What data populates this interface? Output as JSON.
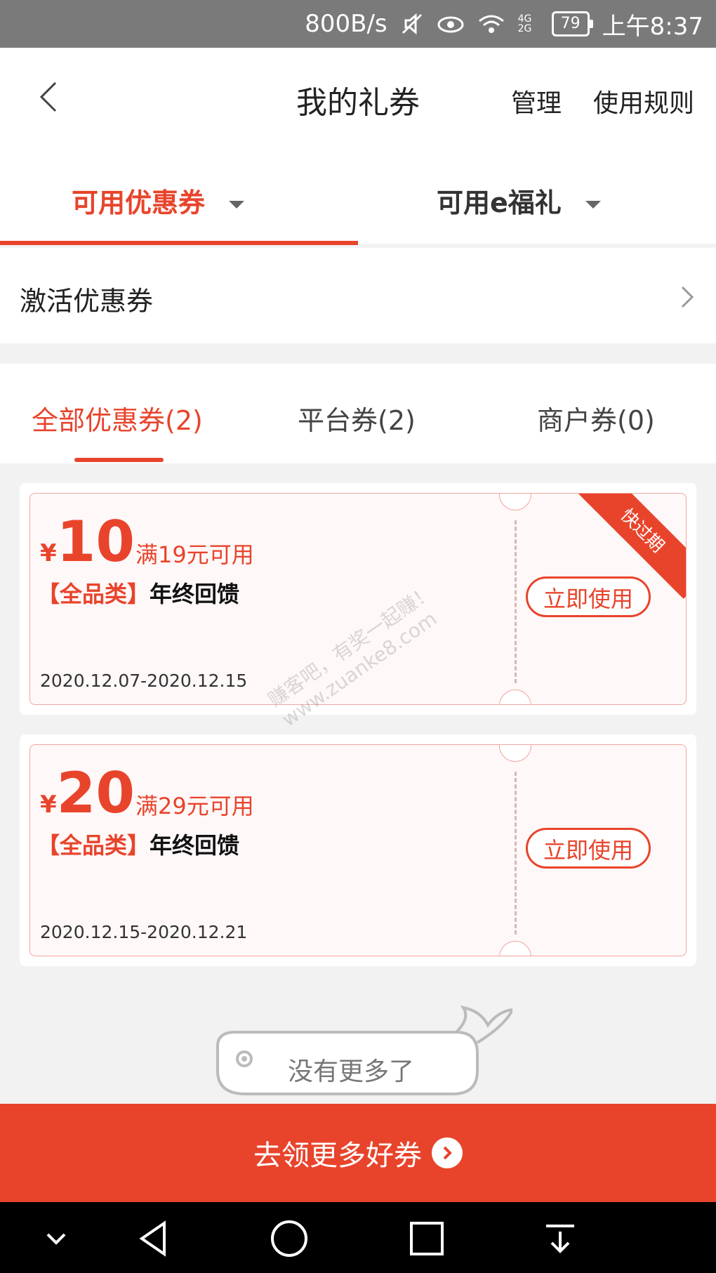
{
  "status_bar": {
    "speed": "800B/s",
    "network": "4G 2G",
    "battery": "79",
    "time": "上午8:37"
  },
  "header": {
    "title": "我的礼券",
    "manage": "管理",
    "rules": "使用规则"
  },
  "top_tabs": [
    "可用优惠券",
    "可用e福礼"
  ],
  "activate": {
    "label": "激活优惠券"
  },
  "sub_tabs": [
    "全部优惠券(2)",
    "平台券(2)",
    "商户券(0)"
  ],
  "coupons": [
    {
      "currency": "¥",
      "amount": "10",
      "condition": "满19元可用",
      "tag": "【全品类】",
      "name": "年终回馈",
      "date": "2020.12.07-2020.12.15",
      "button": "立即使用",
      "badge": "快过期"
    },
    {
      "currency": "¥",
      "amount": "20",
      "condition": "满29元可用",
      "tag": "【全品类】",
      "name": "年终回馈",
      "date": "2020.12.15-2020.12.21",
      "button": "立即使用"
    }
  ],
  "watermark": {
    "line1": "赚客吧，有奖一起赚！",
    "line2": "www.zuanke8.com"
  },
  "no_more": "没有更多了",
  "cta": {
    "label": "去领更多好券"
  },
  "colors": {
    "accent": "#e8442c",
    "background": "#f2f2f2"
  }
}
